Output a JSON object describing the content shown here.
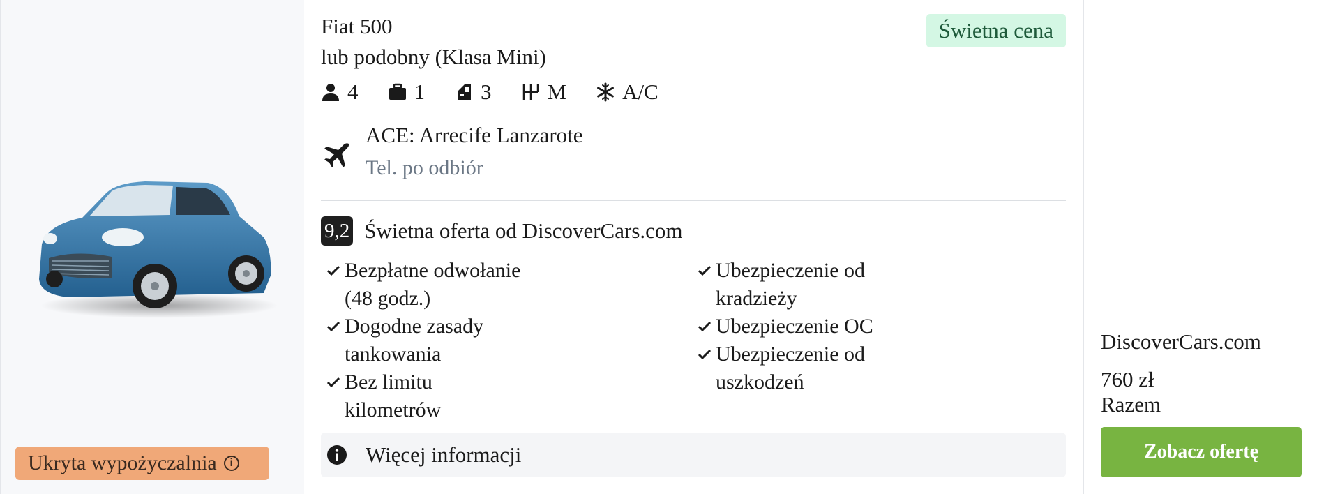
{
  "car": {
    "name": "Fiat 500",
    "similar": "lub podobny (Klasa Mini)",
    "deal_badge": "Świetna cena",
    "features": [
      {
        "icon": "person-icon",
        "value": "4"
      },
      {
        "icon": "suitcase-icon",
        "value": "1"
      },
      {
        "icon": "door-icon",
        "value": "3"
      },
      {
        "icon": "gearshift-icon",
        "value": "M"
      },
      {
        "icon": "snowflake-icon",
        "value": "A/C"
      }
    ]
  },
  "location": {
    "icon": "airplane-icon",
    "name": "ACE: Arrecife Lanzarote",
    "note": "Tel. po odbiór"
  },
  "rating": {
    "score": "9,2",
    "text": "Świetna oferta od DiscoverCars.com"
  },
  "benefits": {
    "col1": [
      {
        "lines": [
          "Bezpłatne odwołanie",
          "(48 godz.)"
        ]
      },
      {
        "lines": [
          "Dogodne zasady",
          "tankowania"
        ]
      },
      {
        "lines": [
          "Bez limitu",
          "kilometrów"
        ]
      }
    ],
    "col2": [
      {
        "lines": [
          "Ubezpieczenie od",
          "kradzieży"
        ]
      },
      {
        "lines": [
          "Ubezpieczenie OC"
        ]
      },
      {
        "lines": [
          "Ubezpieczenie od",
          "uszkodzeń"
        ]
      }
    ]
  },
  "more_info": "Więcej informacji",
  "hidden_rental": "Ukryta wypożyczalnia",
  "offer": {
    "provider": "DiscoverCars.com",
    "price": "760 zł",
    "total_label": "Razem",
    "cta_label": "Zobacz ofertę"
  },
  "colors": {
    "deal_badge_bg": "#d4f7e4",
    "hidden_badge_bg": "#f0a878",
    "cta_bg": "#78b441",
    "score_bg": "#1f1f1f"
  }
}
